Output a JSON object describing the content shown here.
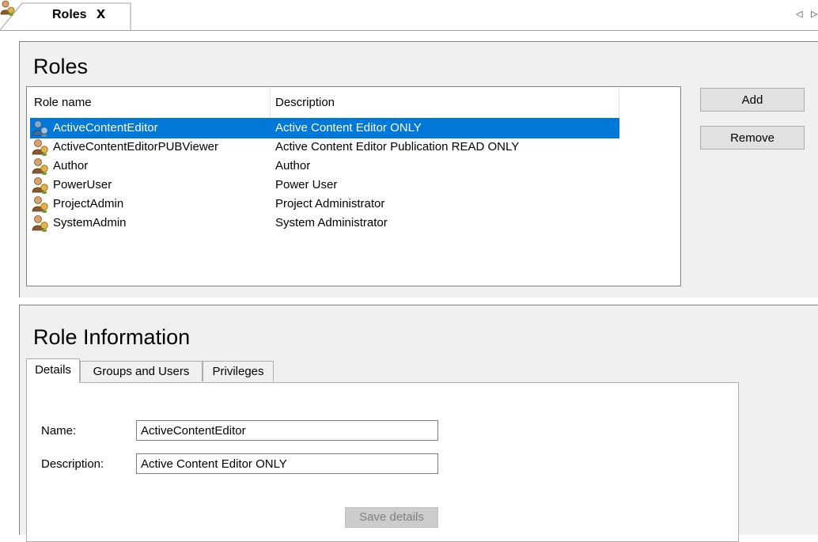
{
  "document_tab": {
    "title": "Roles",
    "close_glyph": "x",
    "icon": "role-user-icon"
  },
  "tab_scroll": {
    "left_glyph": "◁",
    "right_glyph": "▷"
  },
  "roles_panel": {
    "title": "Roles",
    "columns": {
      "name": "Role name",
      "description": "Description"
    },
    "rows": [
      {
        "name": "ActiveContentEditor",
        "description": "Active Content Editor ONLY",
        "selected": true
      },
      {
        "name": "ActiveContentEditorPUBViewer",
        "description": "Active Content Editor Publication READ ONLY",
        "selected": false
      },
      {
        "name": "Author",
        "description": "Author",
        "selected": false
      },
      {
        "name": "PowerUser",
        "description": "Power User",
        "selected": false
      },
      {
        "name": "ProjectAdmin",
        "description": "Project Administrator",
        "selected": false
      },
      {
        "name": "SystemAdmin",
        "description": "System Administrator",
        "selected": false
      }
    ],
    "buttons": {
      "add": "Add",
      "remove": "Remove"
    }
  },
  "info_panel": {
    "title": "Role Information",
    "tabs": [
      {
        "label": "Details",
        "active": true
      },
      {
        "label": "Groups and Users",
        "active": false
      },
      {
        "label": "Privileges",
        "active": false
      }
    ],
    "details": {
      "name_label": "Name:",
      "name_value": "ActiveContentEditor",
      "description_label": "Description:",
      "description_value": "Active Content Editor ONLY",
      "save_label": "Save details"
    }
  },
  "colors": {
    "selection": "#0078d7",
    "panel_bg": "#f0f0f0",
    "button_bg": "#e1e1e1"
  }
}
